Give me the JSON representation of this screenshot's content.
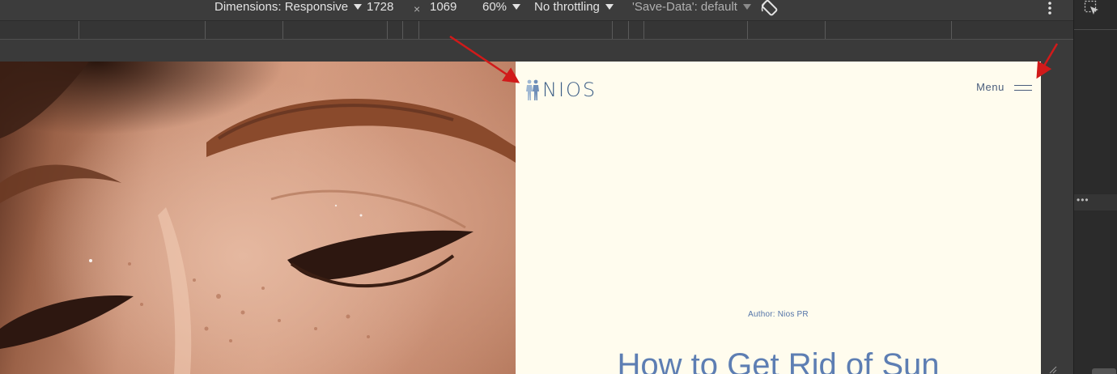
{
  "devtools": {
    "dimensions_label": "Dimensions: Responsive",
    "width": "1728",
    "times_sign": "×",
    "height": "1069",
    "zoom": "60%",
    "throttling": "No throttling",
    "save_data": "'Save-Data': default",
    "side_dots": "•••",
    "icons": [
      "rotate-icon",
      "kebab-icon",
      "inspect-element-icon",
      "resize-handle-icon"
    ]
  },
  "site": {
    "logo_text": "NIOS",
    "menu_label": "Menu",
    "author": "Author: Nios PR",
    "title": "How to Get Rid of Sun",
    "colors": {
      "background": "#fffcee",
      "brand": "#3e5f87",
      "accent": "#5d7eb3"
    }
  },
  "annotations": {
    "arrow_color": "#d11a1a",
    "arrow_count": 2
  }
}
